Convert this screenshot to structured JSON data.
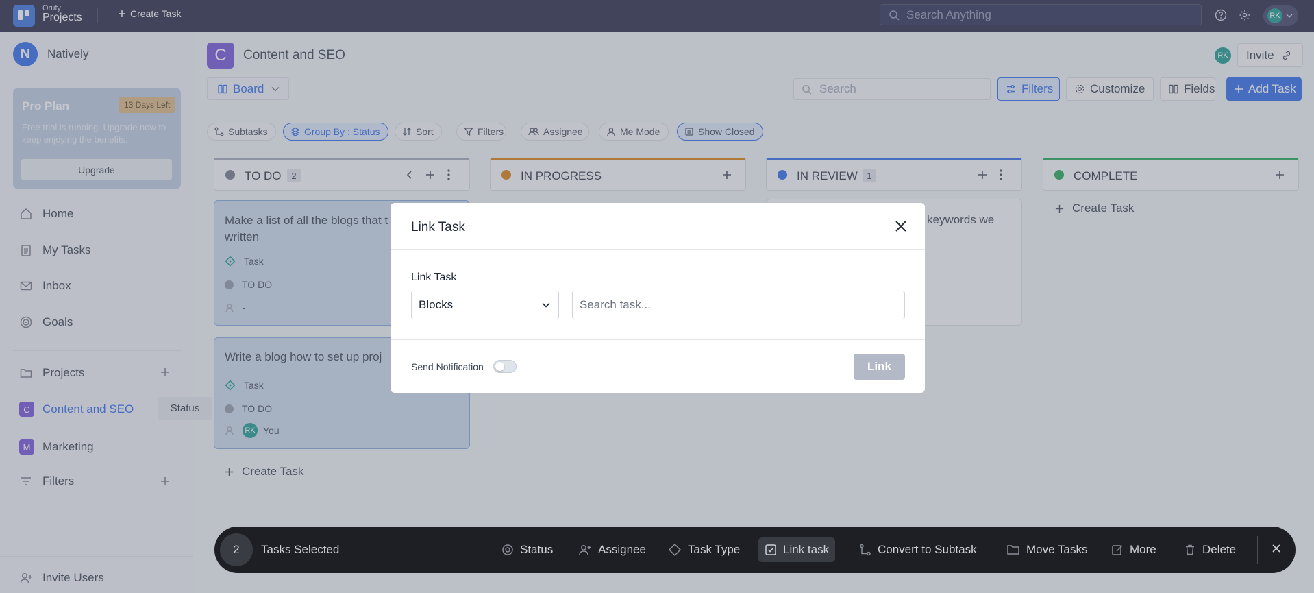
{
  "topbar": {
    "brand_top": "Orufy",
    "brand_bottom": "Projects",
    "create_task": "Create Task",
    "search_placeholder": "Search Anything",
    "avatar_initials": "RK"
  },
  "sidebar": {
    "workspace_initial": "N",
    "workspace_name": "Natively",
    "pro_plan": {
      "title": "Pro Plan",
      "badge": "13 Days Left",
      "text": "Free trial is running. Upgrade now to keep enjoying the benefits.",
      "button": "Upgrade"
    },
    "nav": [
      {
        "label": "Home",
        "icon": "home-icon"
      },
      {
        "label": "My Tasks",
        "icon": "clipboard-icon"
      },
      {
        "label": "Inbox",
        "icon": "mail-icon"
      },
      {
        "label": "Goals",
        "icon": "target-icon"
      }
    ],
    "projects_label": "Projects",
    "projects": [
      {
        "initial": "C",
        "label": "Content and SEO",
        "color": "#6d4ad6"
      },
      {
        "initial": "M",
        "label": "Marketing",
        "color": "#6d4ad6"
      }
    ],
    "filters_label": "Filters",
    "invite_users": "Invite Users",
    "tooltip": "Status"
  },
  "header": {
    "project_initial": "C",
    "project_title": "Content and SEO",
    "avatar_initials": "RK",
    "invite": "Invite",
    "view": "Board",
    "search_placeholder": "Search",
    "filters": "Filters",
    "customize": "Customize",
    "fields": "Fields",
    "add_task": "Add Task"
  },
  "chips": {
    "subtasks": "Subtasks",
    "group_by": "Group By : Status",
    "sort": "Sort",
    "filters": "Filters",
    "assignee": "Assignee",
    "me_mode": "Me Mode",
    "show_closed": "Show Closed"
  },
  "columns": [
    {
      "title": "TO DO",
      "count": "2",
      "color": "#6b7280"
    },
    {
      "title": "IN PROGRESS",
      "count": "",
      "color": "#d97706"
    },
    {
      "title": "IN REVIEW",
      "count": "1",
      "color": "#2563eb"
    },
    {
      "title": "COMPLETE",
      "count": "",
      "color": "#16a34a"
    }
  ],
  "cards": [
    {
      "title": "Make a list of all the blogs that t",
      "title_line2": "written",
      "type": "Task",
      "status": "TO DO",
      "assignee": "-"
    },
    {
      "title": "Write a blog how to set up proj",
      "type": "Task",
      "status": "TO DO",
      "assignee": "You",
      "assignee_initials": "RK"
    }
  ],
  "review_card_fragment": "keywords we",
  "create_task": "Create Task",
  "modal": {
    "title": "Link Task",
    "label": "Link Task",
    "relation": "Blocks",
    "search_placeholder": "Search task...",
    "send_notification": "Send Notification",
    "link_button": "Link"
  },
  "bulk_bar": {
    "count": "2",
    "selected_label": "Tasks Selected",
    "actions": [
      "Status",
      "Assignee",
      "Task Type",
      "Link task",
      "Convert to Subtask",
      "Move Tasks",
      "More",
      "Delete"
    ]
  }
}
